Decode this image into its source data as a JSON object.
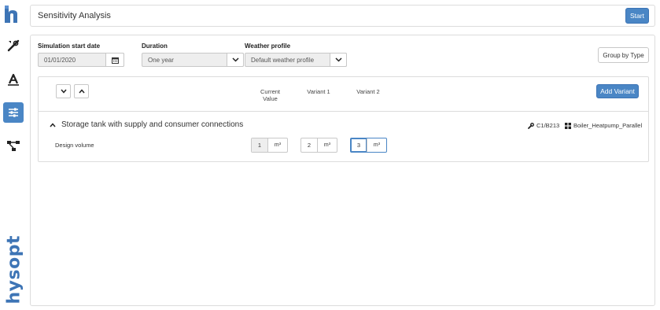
{
  "app": {
    "brand": "hysopt",
    "colors": {
      "accent": "#4a86c5",
      "brand": "#3d74b5",
      "border": "#dcdcdc"
    }
  },
  "sidebar": {
    "items": [
      {
        "icon": "wrench-pencil-icon",
        "active": false
      },
      {
        "icon": "drawing-tool-icon",
        "active": false
      },
      {
        "icon": "sliders-icon",
        "active": true
      },
      {
        "icon": "network-diagram-icon",
        "active": false
      }
    ]
  },
  "header": {
    "title": "Sensitivity Analysis",
    "start_label": "Start"
  },
  "settings": {
    "start_date": {
      "label": "Simulation start date",
      "value": "01/01/2020",
      "icon": "calendar-icon"
    },
    "duration": {
      "label": "Duration",
      "value": "One year",
      "icon": "chevron-down-icon"
    },
    "weather": {
      "label": "Weather profile",
      "value": "Default weather profile",
      "icon": "chevron-down-icon"
    },
    "group_by_label": "Group by Type"
  },
  "table": {
    "columns": {
      "current_line1": "Current",
      "current_line2": "Value",
      "variant1": "Variant 1",
      "variant2": "Variant 2"
    },
    "add_variant_label": "Add Variant",
    "group": {
      "title": "Storage tank with supply and consumer connections",
      "ref_code": "C1/B213",
      "project": "Boiler_Heatpump_Parallel",
      "params": [
        {
          "label": "Design volume",
          "current": "1",
          "variant1": "2",
          "variant2": "3",
          "unit": "m³"
        }
      ]
    }
  }
}
